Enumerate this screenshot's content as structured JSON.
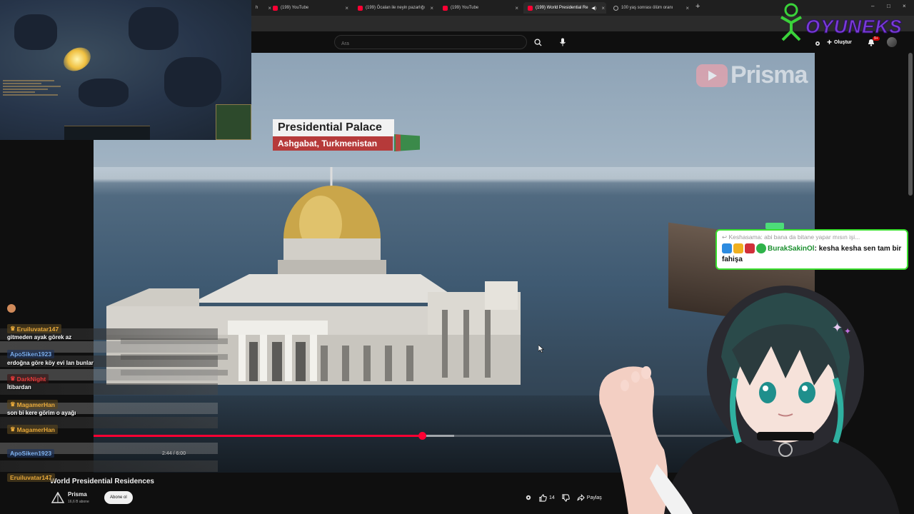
{
  "browser": {
    "tabs": [
      {
        "label": "h",
        "icon": "youtube-icon"
      },
      {
        "label": "(199) YouTube",
        "icon": "youtube-icon"
      },
      {
        "label": "(199) Öcalan ile neyin pazarlığı",
        "icon": "youtube-icon"
      },
      {
        "label": "(199) YouTube",
        "icon": "youtube-icon"
      },
      {
        "label": "(199) World Presidential Re",
        "icon": "youtube-icon",
        "active": true
      },
      {
        "label": "100 yaş sonrası ölüm oranı",
        "icon": "globe-icon"
      }
    ],
    "new_tab": "+",
    "window_controls": [
      "–",
      "□",
      "×"
    ]
  },
  "youtube": {
    "search_placeholder": "Ara",
    "create_label": "Oluştur",
    "notification_badge": "9+"
  },
  "video": {
    "overlay_title": "Presidential Palace",
    "overlay_subtitle": "Ashgabat, Turkmenistan",
    "watermark": "Prisma",
    "current_time": "2:44",
    "duration": "6:00",
    "time_display": "2:44 / 6:00",
    "progress_fraction": 0.4556,
    "buffered_fraction": 0.5
  },
  "below": {
    "title": "World Presidential Residences",
    "channel_name": "Prisma",
    "channel_subs": "16,6 B abone",
    "subscribe_label": "Abone ol",
    "like_count": "14",
    "share_label": "Paylaş"
  },
  "chat": [
    {
      "name": "",
      "text": "",
      "color": "#d08a5a"
    },
    {
      "name": "Eruiluvatar147",
      "text": "gitmeden ayak görek az",
      "color": "#e8a93a"
    },
    {
      "name": "ApoSiken1923",
      "text": "erdoğna göre köy evi lan bunlar",
      "color": "#5a9ae8"
    },
    {
      "name": "DarkNight",
      "text": "İtibardan",
      "color": "#e23a3a"
    },
    {
      "name": "MagamerHan",
      "text": "son bi kere görim o ayağı",
      "color": "#e8a93a"
    },
    {
      "name": "MagamerHan",
      "text": "",
      "color": "#e8a93a"
    },
    {
      "name": "ApoSiken1923",
      "text": "",
      "color": "#5a9ae8"
    },
    {
      "name": "Eruiluvatar147",
      "text": "",
      "color": "#e8a93a"
    }
  ],
  "popup": {
    "reply_to": "Keshasama: abi bana da bitane yapar mısın işi...",
    "username": "BurakSakinOl",
    "message": "kesha kesha sen tam bir fahişa",
    "border_color": "#3adf2e"
  },
  "brand": {
    "text": "OYUNEKS",
    "color": "#7a3bd8"
  }
}
